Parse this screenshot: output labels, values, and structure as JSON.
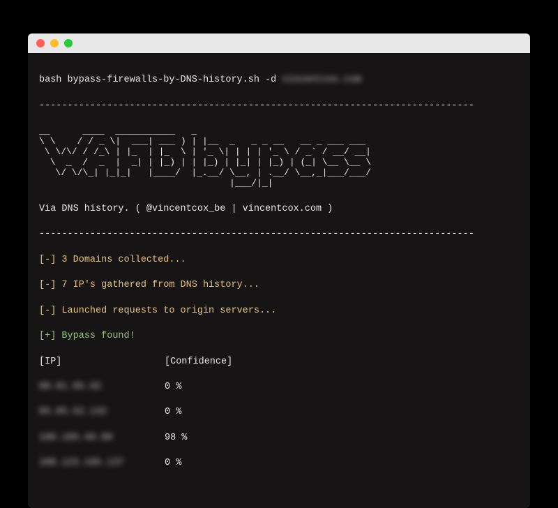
{
  "command": {
    "shell": "bash",
    "script": "bypass-firewalls-by-DNS-history.sh",
    "flag": "-d",
    "domain_arg": "vincentcox.com"
  },
  "separator": "-----------------------------------------------------------------------------",
  "ascii_art": "__      ____  ___________   _\n\\ \\    / / _ \\|  ___| ___ ) | |__  _   _ _ __   __ _ ___ ___\n \\ \\/\\/ / /_\\ | |_  | |_  \\ | '_ \\| | | | '_ \\ / _` / __/ __|\n  \\  _  /  _  |  _| | |_) | | |_) | |_| | |_) | (_| \\__ \\__ \\\n   \\/ \\/\\_| |_|_|   |____/  |_.__/ \\__, | .__/ \\__,_|___/___/\n                                   |___/|_|",
  "subtitle": "Via DNS history. ( @vincentcox_be | vincentcox.com )",
  "status": {
    "s1": {
      "prefix": "[-]",
      "text": " 3 Domains collected..."
    },
    "s2": {
      "prefix": "[-]",
      "text": " 7 IP's gathered from DNS history..."
    },
    "s3": {
      "prefix": "[-]",
      "text": " Launched requests to origin servers..."
    },
    "s4": {
      "prefix": "[+]",
      "text": " Bypass found!"
    }
  },
  "table": {
    "headers": {
      "ip": "[IP]",
      "conf": "[Confidence]"
    },
    "rows": [
      {
        "ip": "80.81.85.92",
        "confidence": "0 %"
      },
      {
        "ip": "85.85.52.132",
        "confidence": "0 %"
      },
      {
        "ip": "188.166.49.80",
        "confidence": "98 %"
      },
      {
        "ip": "108.123.195.137",
        "confidence": "0 %"
      }
    ]
  }
}
